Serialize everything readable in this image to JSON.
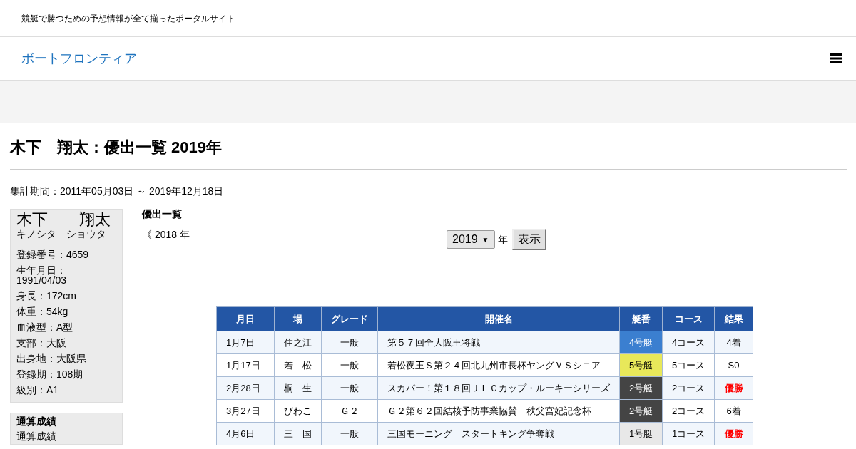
{
  "header": {
    "tagline": "競艇で勝つための予想情報が全て揃ったポータルサイト",
    "brand": "ボートフロンティア"
  },
  "page_title": "木下　翔太：優出一覧 2019年",
  "period": "集計期間：2011年05月03日 ～ 2019年12月18日",
  "profile": {
    "name": "木下　　翔太",
    "kana": "キノシタ　ショウタ",
    "fields": [
      "登録番号：4659",
      "生年月日：\n1991/04/03",
      "身長：172cm",
      "体重：54kg",
      "血液型：A型",
      "支部：大阪",
      "出身地：大阪県",
      "登録期：108期",
      "級別：A1"
    ]
  },
  "menu": {
    "heading": "通算成績",
    "items": [
      "通算成績"
    ]
  },
  "section_title": "優出一覧",
  "prev_link": {
    "arrow": "《",
    "label": "2018 年"
  },
  "year_select": {
    "value": "2019",
    "arrow": "▼",
    "unit": "年",
    "button": "表示"
  },
  "table": {
    "columns": [
      "月日",
      "場",
      "グレード",
      "開催名",
      "艇番",
      "コース",
      "結果"
    ],
    "rows": [
      {
        "date": "1月7日",
        "venue": "住之江",
        "grade": "一般",
        "race": "第５７回全大阪王将戦",
        "boat": "4号艇",
        "color": "#3b7fd0",
        "course": "4コース",
        "result": "4着",
        "winner": false
      },
      {
        "date": "1月17日",
        "venue": "若　松",
        "grade": "一般",
        "race": "若松夜王Ｓ第２４回北九州市長杯ヤングＶＳシニア",
        "boat": "5号艇",
        "color": "#e8e85a",
        "course": "5コース",
        "result": "S0",
        "winner": false
      },
      {
        "date": "2月28日",
        "venue": "桐　生",
        "grade": "一般",
        "race": "スカパー！第１８回ＪＬＣカップ・ルーキーシリーズ",
        "boat": "2号艇",
        "color": "#444444",
        "course": "2コース",
        "result": "優勝",
        "winner": true
      },
      {
        "date": "3月27日",
        "venue": "びわこ",
        "grade": "Ｇ２",
        "race": "Ｇ２第６２回結核予防事業協賛　秩父宮妃記念杯",
        "boat": "2号艇",
        "color": "#444444",
        "course": "2コース",
        "result": "6着",
        "winner": false
      },
      {
        "date": "4月6日",
        "venue": "三　国",
        "grade": "一般",
        "race": "三国モーニング　スタートキング争奪戦",
        "boat": "1号艇",
        "color": "#e8e8e8",
        "course": "1コース",
        "result": "優勝",
        "winner": true
      }
    ]
  }
}
